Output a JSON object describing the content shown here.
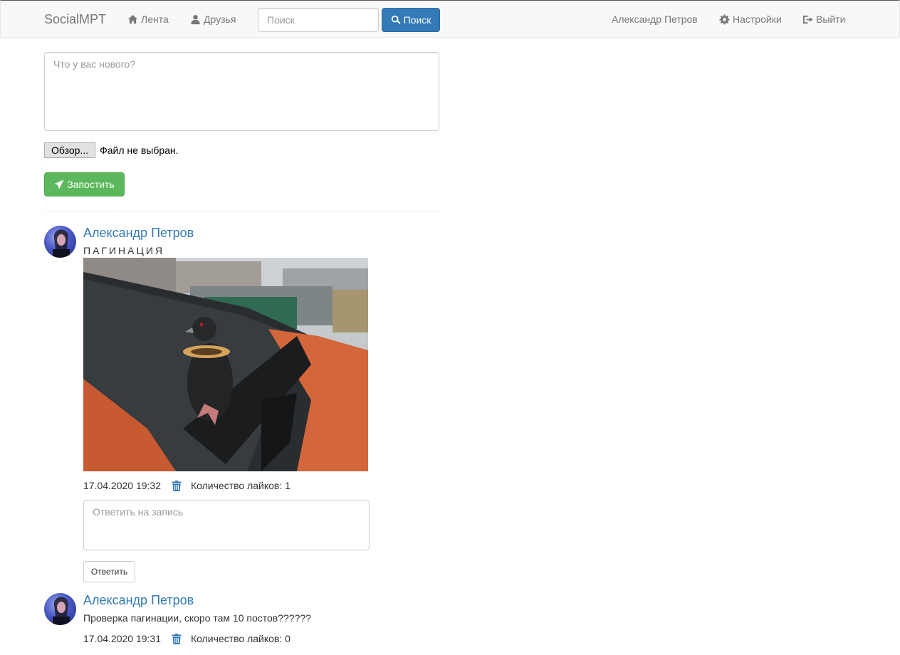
{
  "navbar": {
    "brand": "SocialMPT",
    "feed_label": "Лента",
    "friends_label": "Друзья",
    "search_placeholder": "Поиск",
    "search_button": "Поиск",
    "user_name": "Александр Петров",
    "settings_label": "Настройки",
    "logout_label": "Выйти"
  },
  "composer": {
    "placeholder": "Что у вас нового?",
    "file_button": "Обзор...",
    "file_status": "Файл не выбран.",
    "submit_label": "Запостить"
  },
  "posts": [
    {
      "author": "Александр Петров",
      "text": "ПАГИНАЦИЯ",
      "has_image": true,
      "date": "17.04.2020 19:32",
      "likes": "Количество лайков: 1",
      "reply_placeholder": "Ответить на запись",
      "reply_button": "Ответить"
    },
    {
      "author": "Александр Петров",
      "text": "Проверка пагинации, скоро там 10 постов??????",
      "has_image": false,
      "date": "17.04.2020 19:31",
      "likes": "Количество лайков: 0"
    }
  ],
  "colors": {
    "link": "#337ab7",
    "primary": "#337ab7",
    "success": "#5cb85c",
    "navbar_bg": "#f8f8f8"
  }
}
